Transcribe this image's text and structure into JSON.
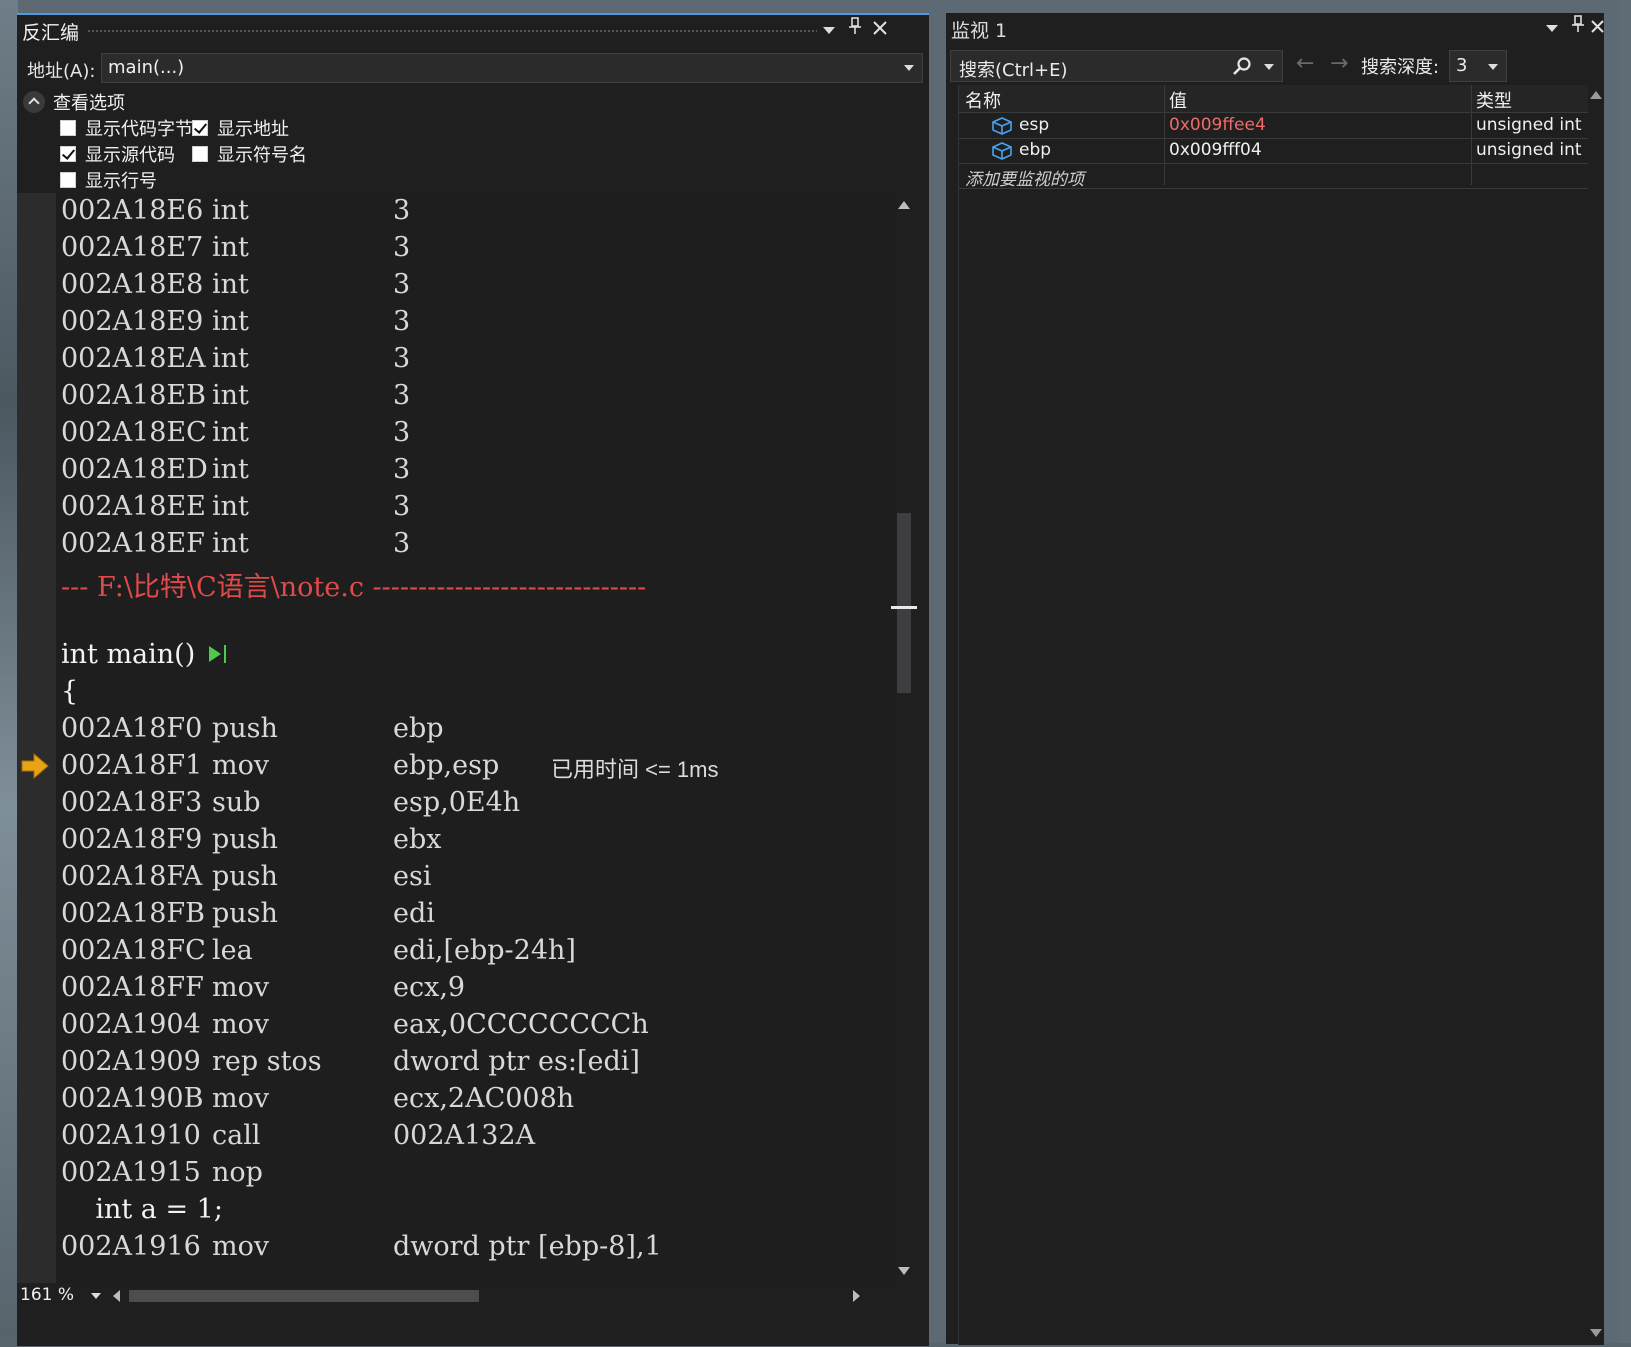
{
  "disasm": {
    "title": "反汇编",
    "address_label": "地址(A):",
    "address_value": "main(...)",
    "view_options_label": "查看选项",
    "options": {
      "show_code_bytes": {
        "label": "显示代码字节",
        "checked": false
      },
      "show_address": {
        "label": "显示地址",
        "checked": true
      },
      "show_source": {
        "label": "显示源代码",
        "checked": true
      },
      "show_symbols": {
        "label": "显示符号名",
        "checked": false
      },
      "show_line_numbers": {
        "label": "显示行号",
        "checked": false
      }
    },
    "lines": [
      {
        "addr": "002A18E6",
        "op": "int",
        "arg": "3"
      },
      {
        "addr": "002A18E7",
        "op": "int",
        "arg": "3"
      },
      {
        "addr": "002A18E8",
        "op": "int",
        "arg": "3"
      },
      {
        "addr": "002A18E9",
        "op": "int",
        "arg": "3"
      },
      {
        "addr": "002A18EA",
        "op": "int",
        "arg": "3"
      },
      {
        "addr": "002A18EB",
        "op": "int",
        "arg": "3"
      },
      {
        "addr": "002A18EC",
        "op": "int",
        "arg": "3"
      },
      {
        "addr": "002A18ED",
        "op": "int",
        "arg": "3"
      },
      {
        "addr": "002A18EE",
        "op": "int",
        "arg": "3"
      },
      {
        "addr": "002A18EF",
        "op": "int",
        "arg": "3"
      },
      {
        "source_file": "--- F:\\比特\\C语言\\note.c ------------------------------"
      },
      {
        "blank": true
      },
      {
        "source": "int main()",
        "run_icon": true
      },
      {
        "source": "{"
      },
      {
        "addr": "002A18F0",
        "op": "push",
        "arg": "ebp"
      },
      {
        "addr": "002A18F1",
        "op": "mov",
        "arg": "ebp,esp",
        "note": "已用时间 <= 1ms",
        "current": true
      },
      {
        "addr": "002A18F3",
        "op": "sub",
        "arg": "esp,0E4h"
      },
      {
        "addr": "002A18F9",
        "op": "push",
        "arg": "ebx"
      },
      {
        "addr": "002A18FA",
        "op": "push",
        "arg": "esi"
      },
      {
        "addr": "002A18FB",
        "op": "push",
        "arg": "edi"
      },
      {
        "addr": "002A18FC",
        "op": "lea",
        "arg": "edi,[ebp-24h]"
      },
      {
        "addr": "002A18FF",
        "op": "mov",
        "arg": "ecx,9"
      },
      {
        "addr": "002A1904",
        "op": "mov",
        "arg": "eax,0CCCCCCCCh"
      },
      {
        "addr": "002A1909",
        "op": "rep stos",
        "arg": "dword ptr es:[edi]"
      },
      {
        "addr": "002A190B",
        "op": "mov",
        "arg": "ecx,2AC008h"
      },
      {
        "addr": "002A1910",
        "op": "call",
        "arg": "002A132A"
      },
      {
        "addr": "002A1915",
        "op": "nop",
        "arg": ""
      },
      {
        "source": "    int a = 1;"
      },
      {
        "addr": "002A1916",
        "op": "mov",
        "arg": "dword ptr [ebp-8],1"
      }
    ],
    "zoom": "161 %"
  },
  "watch": {
    "title": "监视 1",
    "search_placeholder": "搜索(Ctrl+E)",
    "depth_label": "搜索深度:",
    "depth_value": "3",
    "columns": {
      "name": "名称",
      "value": "值",
      "type": "类型"
    },
    "rows": [
      {
        "name": "esp",
        "value": "0x009ffee4",
        "type": "unsigned int",
        "changed": true
      },
      {
        "name": "ebp",
        "value": "0x009fff04",
        "type": "unsigned int",
        "changed": false
      }
    ],
    "add_hint": "添加要监视的项"
  },
  "colors": {
    "accent": "#4f9de0",
    "panel_bg": "#1e1e1e",
    "source_file_red": "#e04a4a",
    "changed_value_red": "#f06a6a",
    "ip_arrow": "#e8a317",
    "run_green": "#4ec94e"
  }
}
